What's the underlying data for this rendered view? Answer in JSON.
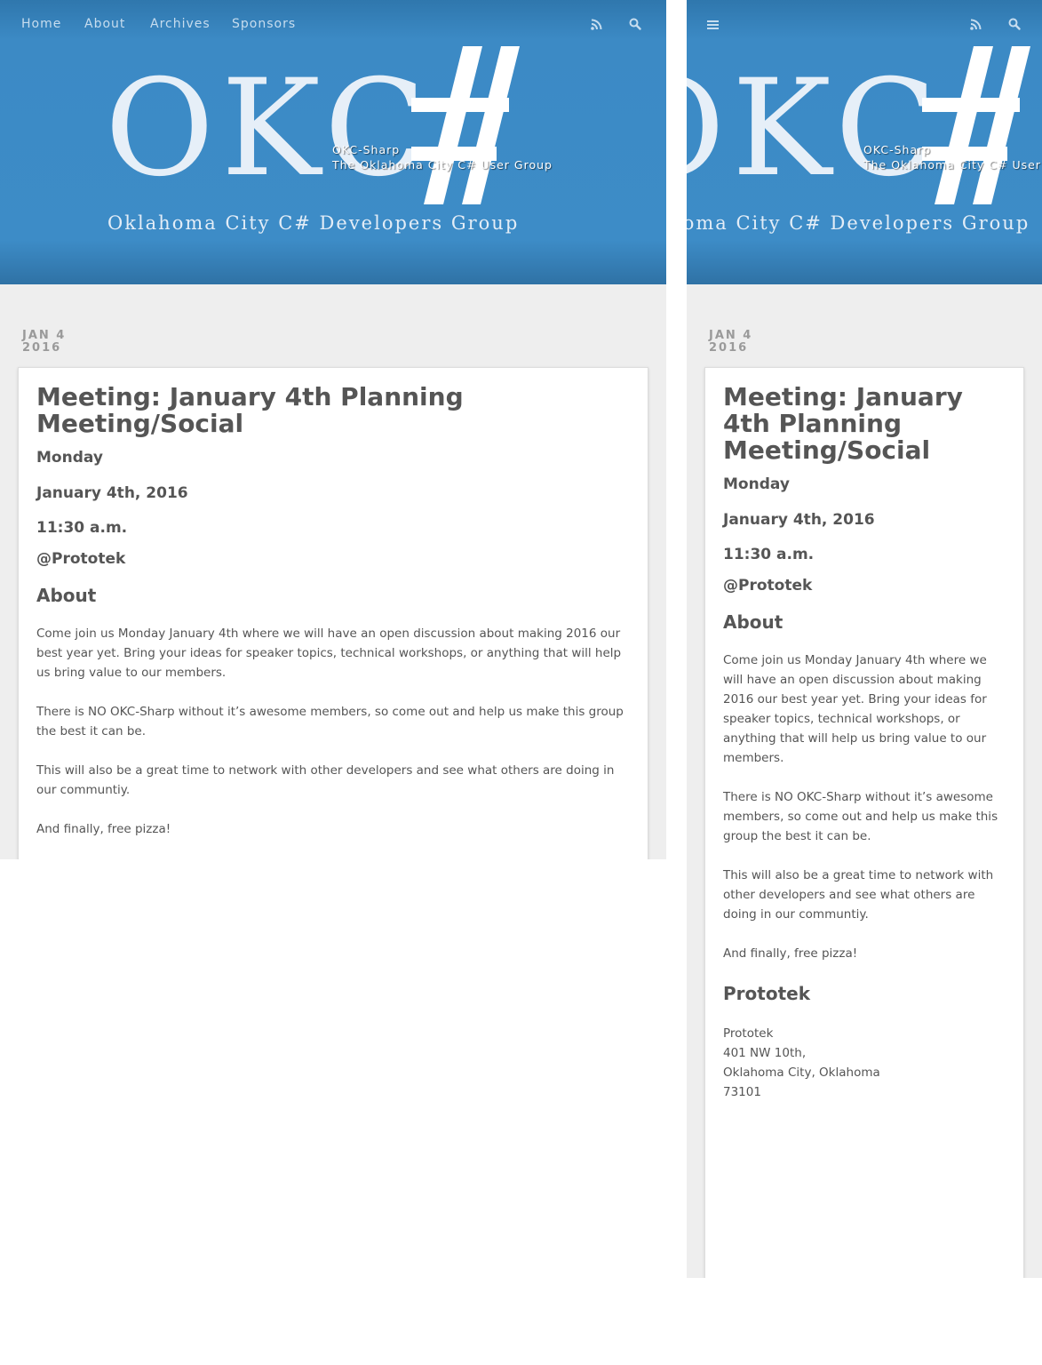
{
  "site": {
    "name": "OKC-Sharp",
    "tagline": "The Oklahoma City C# User Group"
  },
  "logo": {
    "wordmark": "OKC",
    "subtitle": "Oklahoma City C# Developers Group"
  },
  "nav": {
    "items": [
      {
        "label": "Home"
      },
      {
        "label": "About"
      },
      {
        "label": "Archives"
      },
      {
        "label": "Sponsors"
      }
    ],
    "icons": [
      "rss-icon",
      "search-icon",
      "hamburger-menu-icon"
    ]
  },
  "post": {
    "date_month_day": "JAN 4",
    "date_year": "2016",
    "title": "Meeting: January 4th Planning Meeting/Social",
    "day": "Monday",
    "date_full": "January 4th, 2016",
    "time": "11:30 a.m.",
    "venue_handle": "@Prototek",
    "about_heading": "About",
    "paragraphs": [
      "Come join us Monday January 4th where we will have an open discussion about making 2016 our best year yet. Bring your ideas for speaker topics, technical workshops, or anything that will help us bring value to our members.",
      "There is NO OKC-Sharp without it’s awesome members, so come out and help us make this group the best it can be.",
      "This will also be a great time to network with other developers and see what others are doing in our communtiy.",
      "And finally, free pizza!"
    ],
    "location_heading": "Prototek",
    "address": [
      "Prototek",
      "401 NW 10th,",
      "Oklahoma City, Oklahoma",
      "73101"
    ]
  },
  "colors": {
    "banner_blue": "#3c8ac5",
    "page_bg": "#eeeeee",
    "text": "#555555",
    "date_gray": "#9a9a9a"
  }
}
